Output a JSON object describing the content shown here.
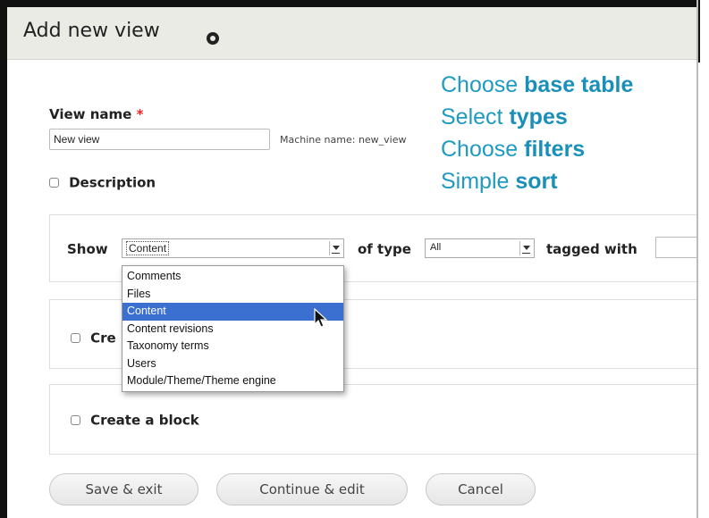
{
  "header": {
    "title": "Add new view"
  },
  "form": {
    "view_name_label": "View name",
    "required_marker": "*",
    "view_name_value": "New view",
    "machine_name": "Machine name: new_view",
    "description_label": "Description"
  },
  "overlay": {
    "lines": [
      {
        "prefix": "Choose ",
        "bold": "base table"
      },
      {
        "prefix": "Select ",
        "bold": "types"
      },
      {
        "prefix": "Choose ",
        "bold": "filters"
      },
      {
        "prefix": "Simple ",
        "bold": "sort"
      }
    ]
  },
  "wizard": {
    "show_label": "Show",
    "show_value": "Content",
    "of_type_label": "of type",
    "of_type_value": "All",
    "tagged_with_label": "tagged with",
    "tagged_with_value": ""
  },
  "dropdown": {
    "options": [
      "Comments",
      "Files",
      "Content",
      "Content revisions",
      "Taxonomy terms",
      "Users",
      "Module/Theme/Theme engine"
    ],
    "selected_index": 2
  },
  "create_page_label": "Cre",
  "create_block_label": "Create a block",
  "buttons": {
    "save_exit": "Save & exit",
    "continue_edit": "Continue & edit",
    "cancel": "Cancel"
  },
  "colors": {
    "header_bg": "#ebebe6",
    "overlay_text": "#1f9ac0",
    "dropdown_selected": "#3b6fd0"
  }
}
